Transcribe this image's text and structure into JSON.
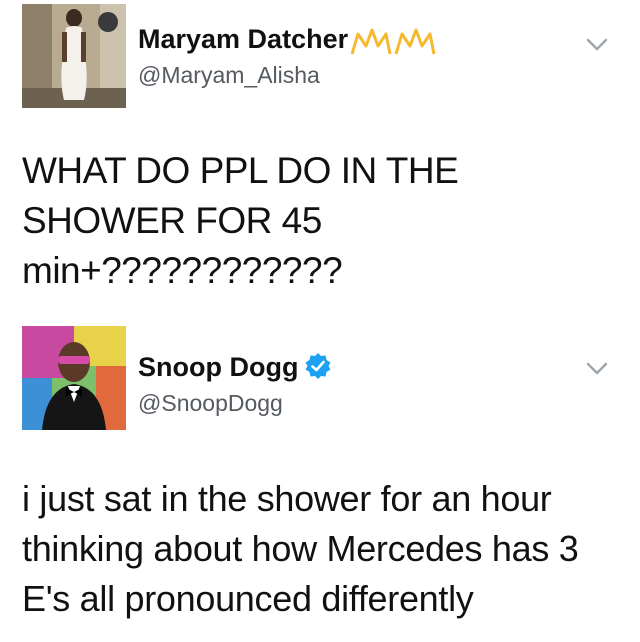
{
  "tweets": [
    {
      "name": "Maryam Datcher",
      "handle": "@Maryam_Alisha",
      "lines": [
        "WHAT DO PPL DO IN THE",
        "SHOWER FOR 45",
        "min+????????????"
      ]
    },
    {
      "name": "Snoop Dogg",
      "handle": "@SnoopDogg",
      "lines": [
        "i just sat in the shower for an hour",
        "thinking about how Mercedes has 3",
        "E's all pronounced differently"
      ]
    }
  ],
  "icons": {
    "chevron": "chevron-down-icon",
    "verified": "verified-badge-icon",
    "crown": "crown-emoji-icon"
  },
  "colors": {
    "verified_blue": "#1da1f2",
    "crown_gold": "#f5b82e",
    "chevron_gray": "#a0a6ad",
    "handle_gray": "#555a60"
  }
}
